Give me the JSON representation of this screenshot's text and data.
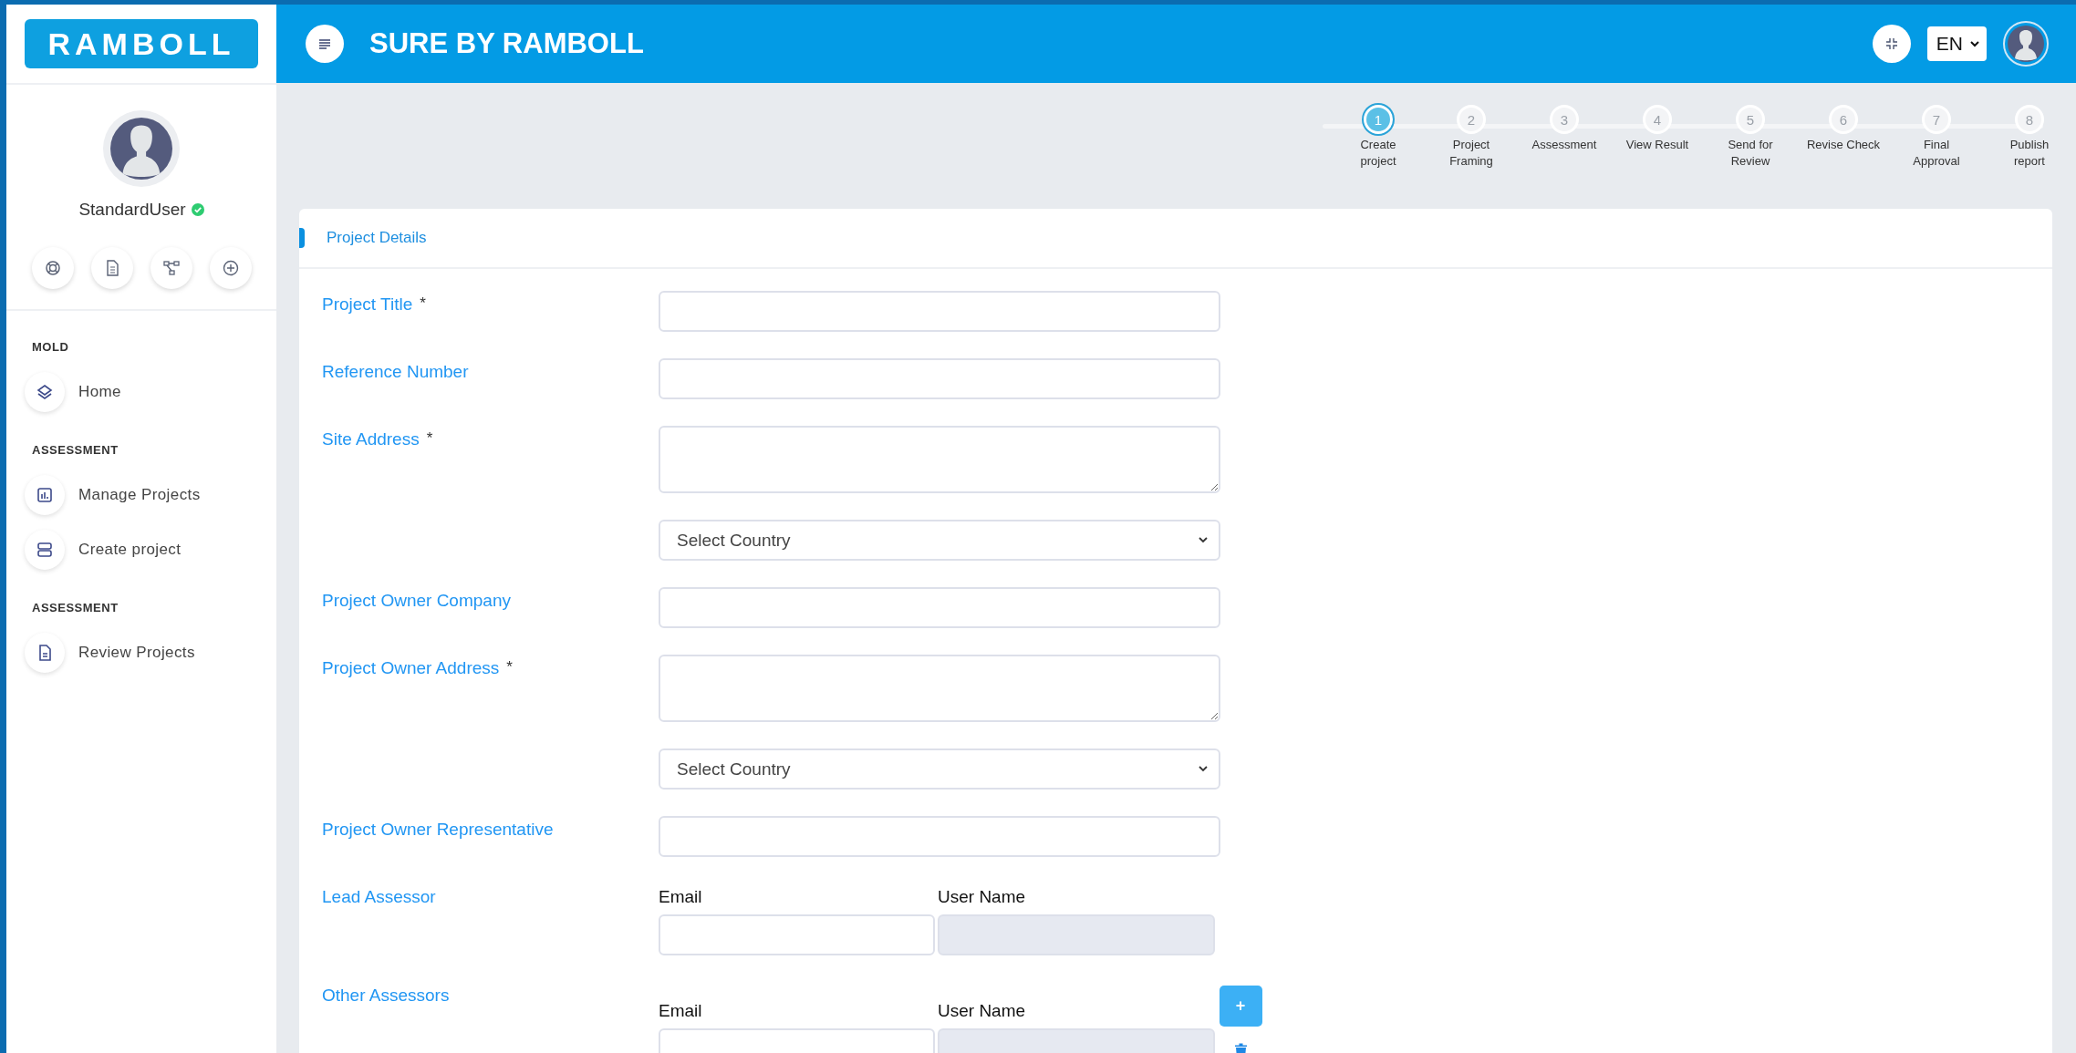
{
  "sidebar": {
    "logo": "RAMBOLL",
    "user": {
      "name": "StandardUser",
      "online": true
    },
    "sections": [
      {
        "heading": "MOLD",
        "items": [
          {
            "label": "Home"
          }
        ]
      },
      {
        "heading": "ASSESSMENT",
        "items": [
          {
            "label": "Manage Projects"
          },
          {
            "label": "Create project"
          }
        ]
      },
      {
        "heading": "ASSESSMENT",
        "items": [
          {
            "label": "Review Projects"
          }
        ]
      }
    ]
  },
  "header": {
    "title": "SURE BY RAMBOLL",
    "language": "EN"
  },
  "steps": [
    {
      "number": "1",
      "label": "Create\nproject",
      "selected": true
    },
    {
      "number": "2",
      "label": "Project\nFraming",
      "selected": false
    },
    {
      "number": "3",
      "label": "Assessment",
      "selected": false
    },
    {
      "number": "4",
      "label": "View Result",
      "selected": false
    },
    {
      "number": "5",
      "label": "Send for\nReview",
      "selected": false
    },
    {
      "number": "6",
      "label": "Revise Check",
      "selected": false
    },
    {
      "number": "7",
      "label": "Final\nApproval",
      "selected": false
    },
    {
      "number": "8",
      "label": "Publish\nreport",
      "selected": false
    }
  ],
  "card": {
    "title": "Project Details",
    "fields": [
      {
        "kind": "text",
        "label": "Project Title",
        "required_mark": "*"
      },
      {
        "kind": "text",
        "label": "Reference Number"
      },
      {
        "kind": "textarea",
        "label": "Site Address",
        "required_mark": "*"
      },
      {
        "kind": "select",
        "value": "Select Country"
      },
      {
        "kind": "text",
        "label": "Project Owner Company"
      },
      {
        "kind": "textarea",
        "label": "Project Owner Address",
        "required_mark": "*"
      },
      {
        "kind": "select",
        "value": "Select Country"
      },
      {
        "kind": "text",
        "label": "Project Owner Representative"
      },
      {
        "kind": "assessor",
        "label": "Lead Assessor",
        "columns": [
          {
            "label": "Email",
            "disabled": false
          },
          {
            "label": "User Name",
            "disabled": true
          }
        ],
        "removable": false
      },
      {
        "kind": "assessor",
        "label": "Other Assessors",
        "columns": [
          {
            "label": "Email",
            "disabled": false
          },
          {
            "label": "User Name",
            "disabled": true
          }
        ],
        "add_button": "+",
        "removable": true
      }
    ]
  }
}
